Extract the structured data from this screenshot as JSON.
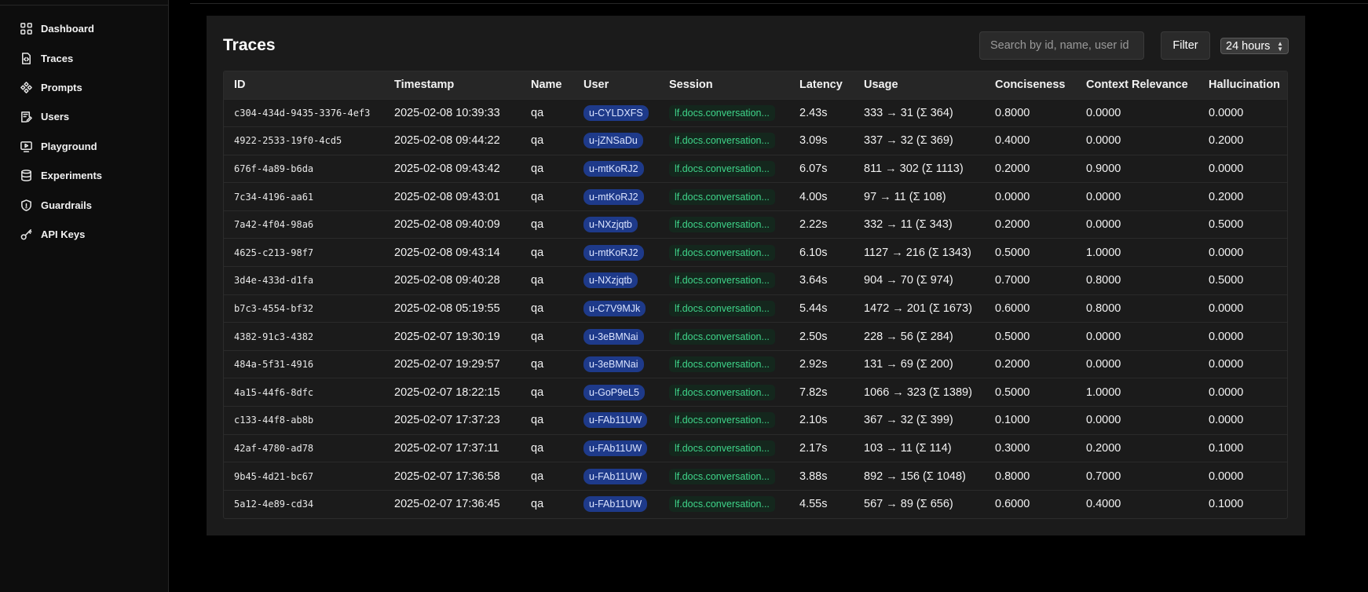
{
  "sidebar": {
    "items": [
      {
        "label": "Dashboard",
        "icon": "dashboard-icon"
      },
      {
        "label": "Traces",
        "icon": "traces-icon"
      },
      {
        "label": "Prompts",
        "icon": "prompts-icon"
      },
      {
        "label": "Users",
        "icon": "users-icon"
      },
      {
        "label": "Playground",
        "icon": "playground-icon"
      },
      {
        "label": "Experiments",
        "icon": "experiments-icon"
      },
      {
        "label": "Guardrails",
        "icon": "shield-icon"
      },
      {
        "label": "API Keys",
        "icon": "key-icon"
      }
    ]
  },
  "traces": {
    "title": "Traces",
    "search_placeholder": "Search by id, name, user id",
    "filter_label": "Filter",
    "time_range": "24 hours",
    "columns": [
      "ID",
      "Timestamp",
      "Name",
      "User",
      "Session",
      "Latency",
      "Usage",
      "Conciseness",
      "Context Relevance",
      "Hallucination"
    ],
    "rows": [
      {
        "id": "c304-434d-9435-3376-4ef3",
        "timestamp": "2025-02-08 10:39:33",
        "name": "qa",
        "user": "u-CYLDXFS",
        "session": "lf.docs.conversation...",
        "latency": "2.43s",
        "usage": "333 → 31 (Σ 364)",
        "conciseness": "0.8000",
        "context_relevance": "0.0000",
        "hallucination": "0.0000"
      },
      {
        "id": "4922-2533-19f0-4cd5",
        "timestamp": "2025-02-08 09:44:22",
        "name": "qa",
        "user": "u-jZNSaDu",
        "session": "lf.docs.conversation...",
        "latency": "3.09s",
        "usage": "337 → 32 (Σ 369)",
        "conciseness": "0.4000",
        "context_relevance": "0.0000",
        "hallucination": "0.2000"
      },
      {
        "id": "676f-4a89-b6da",
        "timestamp": "2025-02-08 09:43:42",
        "name": "qa",
        "user": "u-mtKoRJ2",
        "session": "lf.docs.conversation...",
        "latency": "6.07s",
        "usage": "811 → 302 (Σ 1113)",
        "conciseness": "0.2000",
        "context_relevance": "0.9000",
        "hallucination": "0.0000"
      },
      {
        "id": "7c34-4196-aa61",
        "timestamp": "2025-02-08 09:43:01",
        "name": "qa",
        "user": "u-mtKoRJ2",
        "session": "lf.docs.conversation...",
        "latency": "4.00s",
        "usage": "97 → 11 (Σ 108)",
        "conciseness": "0.0000",
        "context_relevance": "0.0000",
        "hallucination": "0.2000"
      },
      {
        "id": "7a42-4f04-98a6",
        "timestamp": "2025-02-08 09:40:09",
        "name": "qa",
        "user": "u-NXzjqtb",
        "session": "lf.docs.conversation...",
        "latency": "2.22s",
        "usage": "332 → 11 (Σ 343)",
        "conciseness": "0.2000",
        "context_relevance": "0.0000",
        "hallucination": "0.5000"
      },
      {
        "id": "4625-c213-98f7",
        "timestamp": "2025-02-08 09:43:14",
        "name": "qa",
        "user": "u-mtKoRJ2",
        "session": "lf.docs.conversation...",
        "latency": "6.10s",
        "usage": "1127 → 216 (Σ 1343)",
        "conciseness": "0.5000",
        "context_relevance": "1.0000",
        "hallucination": "0.0000"
      },
      {
        "id": "3d4e-433d-d1fa",
        "timestamp": "2025-02-08 09:40:28",
        "name": "qa",
        "user": "u-NXzjqtb",
        "session": "lf.docs.conversation...",
        "latency": "3.64s",
        "usage": "904 → 70 (Σ 974)",
        "conciseness": "0.7000",
        "context_relevance": "0.8000",
        "hallucination": "0.5000"
      },
      {
        "id": "b7c3-4554-bf32",
        "timestamp": "2025-02-08 05:19:55",
        "name": "qa",
        "user": "u-C7V9MJk",
        "session": "lf.docs.conversation...",
        "latency": "5.44s",
        "usage": "1472 → 201 (Σ 1673)",
        "conciseness": "0.6000",
        "context_relevance": "0.8000",
        "hallucination": "0.0000"
      },
      {
        "id": "4382-91c3-4382",
        "timestamp": "2025-02-07 19:30:19",
        "name": "qa",
        "user": "u-3eBMNai",
        "session": "lf.docs.conversation...",
        "latency": "2.50s",
        "usage": "228 → 56 (Σ 284)",
        "conciseness": "0.5000",
        "context_relevance": "0.0000",
        "hallucination": "0.0000"
      },
      {
        "id": "484a-5f31-4916",
        "timestamp": "2025-02-07 19:29:57",
        "name": "qa",
        "user": "u-3eBMNai",
        "session": "lf.docs.conversation...",
        "latency": "2.92s",
        "usage": "131 → 69 (Σ 200)",
        "conciseness": "0.2000",
        "context_relevance": "0.0000",
        "hallucination": "0.0000"
      },
      {
        "id": "4a15-44f6-8dfc",
        "timestamp": "2025-02-07 18:22:15",
        "name": "qa",
        "user": "u-GoP9eL5",
        "session": "lf.docs.conversation...",
        "latency": "7.82s",
        "usage": "1066 → 323 (Σ 1389)",
        "conciseness": "0.5000",
        "context_relevance": "1.0000",
        "hallucination": "0.0000"
      },
      {
        "id": "c133-44f8-ab8b",
        "timestamp": "2025-02-07 17:37:23",
        "name": "qa",
        "user": "u-FAb11UW",
        "session": "lf.docs.conversation...",
        "latency": "2.10s",
        "usage": "367 → 32 (Σ 399)",
        "conciseness": "0.1000",
        "context_relevance": "0.0000",
        "hallucination": "0.0000"
      },
      {
        "id": "42af-4780-ad78",
        "timestamp": "2025-02-07 17:37:11",
        "name": "qa",
        "user": "u-FAb11UW",
        "session": "lf.docs.conversation...",
        "latency": "2.17s",
        "usage": "103 → 11 (Σ 114)",
        "conciseness": "0.3000",
        "context_relevance": "0.2000",
        "hallucination": "0.1000"
      },
      {
        "id": "9b45-4d21-bc67",
        "timestamp": "2025-02-07 17:36:58",
        "name": "qa",
        "user": "u-FAb11UW",
        "session": "lf.docs.conversation...",
        "latency": "3.88s",
        "usage": "892 → 156 (Σ 1048)",
        "conciseness": "0.8000",
        "context_relevance": "0.7000",
        "hallucination": "0.0000"
      },
      {
        "id": "5a12-4e89-cd34",
        "timestamp": "2025-02-07 17:36:45",
        "name": "qa",
        "user": "u-FAb11UW",
        "session": "lf.docs.conversation...",
        "latency": "4.55s",
        "usage": "567 → 89 (Σ 656)",
        "conciseness": "0.6000",
        "context_relevance": "0.4000",
        "hallucination": "0.1000"
      }
    ]
  },
  "colors": {
    "background": "#000000",
    "sidebar": "#0d0d0d",
    "panel": "#1b1b1b",
    "user_badge": "#1e3a8a",
    "session_badge_text": "#3fd58a"
  }
}
